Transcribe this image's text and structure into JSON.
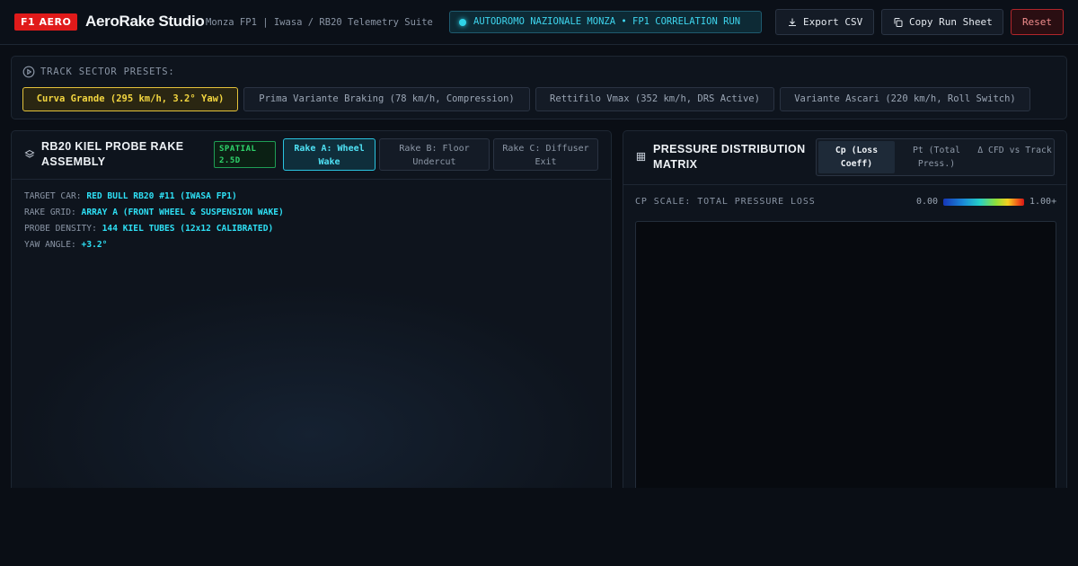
{
  "header": {
    "badge": "F1 AERO",
    "title": "AeroRake Studio",
    "subtitle": "Monza FP1 | Iwasa / RB20 Telemetry Suite",
    "session": "AUTODROMO NAZIONALE MONZA • FP1 CORRELATION RUN",
    "export_label": "Export CSV",
    "copy_label": "Copy Run Sheet",
    "reset_label": "Reset"
  },
  "presets": {
    "label": "TRACK SECTOR PRESETS:",
    "items": [
      {
        "label": "Curva Grande (295 km/h, 3.2° Yaw)"
      },
      {
        "label": "Prima Variante Braking (78 km/h, Compression)"
      },
      {
        "label": "Rettifilo Vmax (352 km/h, DRS Active)"
      },
      {
        "label": "Variante Ascari (220 km/h, Roll Switch)"
      }
    ],
    "active_index": 0
  },
  "rake_panel": {
    "title": "RB20 KIEL PROBE RAKE ASSEMBLY",
    "badge": "SPATIAL 2.5D",
    "tabs": [
      {
        "label": "Rake A: Wheel Wake"
      },
      {
        "label": "Rake B: Floor Undercut"
      },
      {
        "label": "Rake C: Diffuser Exit"
      }
    ],
    "active_tab": 0,
    "info": [
      {
        "key": "TARGET CAR:",
        "value": "RED BULL RB20 #11 (IWASA FP1)"
      },
      {
        "key": "RAKE GRID:",
        "value": "ARRAY A (FRONT WHEEL & SUSPENSION WAKE)"
      },
      {
        "key": "PROBE DENSITY:",
        "value": "144 KIEL TUBES (12x12 CALIBRATED)"
      },
      {
        "key": "YAW ANGLE:",
        "value": "+3.2°"
      }
    ]
  },
  "matrix_panel": {
    "title": "PRESSURE DISTRIBUTION MATRIX",
    "modes": [
      {
        "label": "Cp (Loss Coeff)"
      },
      {
        "label": "Pt (Total Press.)"
      },
      {
        "label": "Δ CFD vs Track"
      }
    ],
    "active_mode": 0,
    "scale_label": "CP SCALE: TOTAL PRESSURE LOSS",
    "scale_min": "0.00",
    "scale_max": "1.00+"
  },
  "colors": {
    "brand_red": "#e01a1a",
    "accent_cyan": "#2ee0f5",
    "preset_active": "#f3d640",
    "badge_green": "#2fd46c",
    "reset_red": "#b0262b"
  },
  "icons": {
    "export": "download-icon",
    "copy": "copy-icon",
    "presets": "play-circle-icon",
    "rake": "layers-icon",
    "matrix": "grid-icon"
  }
}
